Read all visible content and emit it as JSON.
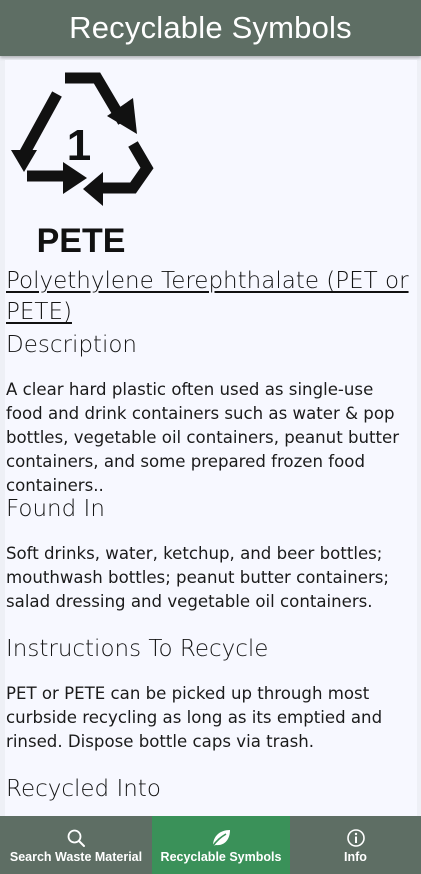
{
  "header": {
    "title": "Recyclable Symbols"
  },
  "symbol": {
    "number": "1",
    "code": "PETE",
    "icon": "recycle-triangle-icon"
  },
  "material": {
    "name": "Polyethylene Terephthalate (PET or PETE)"
  },
  "sections": {
    "description": {
      "heading": "Description",
      "body": "A clear hard plastic often used as single-use food and drink containers such as water & pop bottles, vegetable oil containers, peanut butter containers, and some prepared frozen food containers.."
    },
    "found_in": {
      "heading": "Found In",
      "body": "Soft drinks, water, ketchup, and beer bottles; mouthwash bottles; peanut butter containers; salad dressing and vegetable oil containers."
    },
    "instructions": {
      "heading": "Instructions To Recycle",
      "body": "PET or PETE can be picked up through most curbside recycling as long as its emptied and rinsed. Dispose bottle caps via trash."
    },
    "recycled_into": {
      "heading": "Recycled Into"
    }
  },
  "nav": {
    "search": {
      "label": "Search Waste Material",
      "icon": "search-icon"
    },
    "recyclable": {
      "label": "Recyclable Symbols",
      "icon": "leaf-icon"
    },
    "info": {
      "label": "Info",
      "icon": "info-icon"
    }
  },
  "colors": {
    "header_bg": "#5e6e64",
    "active_tab_bg": "#3a9159",
    "content_bg": "#f7f8ff"
  }
}
